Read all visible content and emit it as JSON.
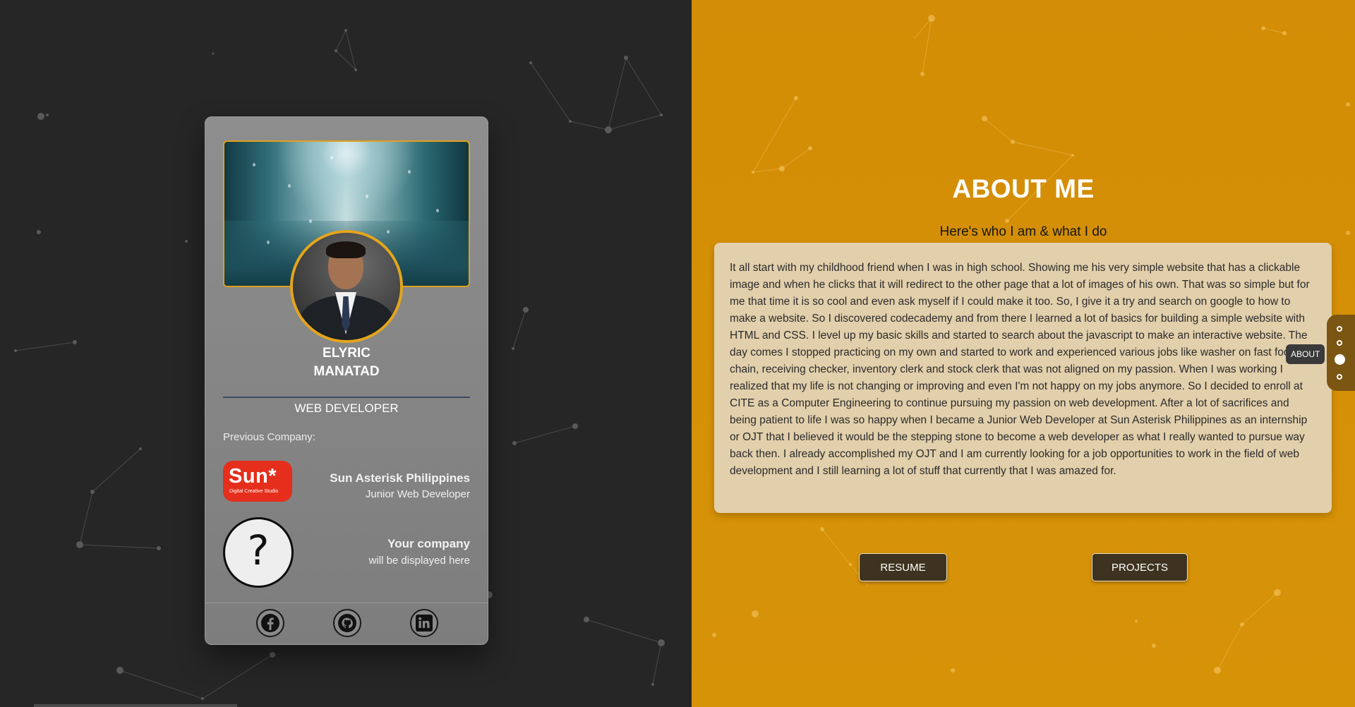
{
  "profile": {
    "first_name": "ELYRIC",
    "last_name": "MANATAD",
    "role": "WEB DEVELOPER",
    "previous_company_label": "Previous Company:",
    "companies": [
      {
        "logo_text": "Sun*",
        "logo_subtext": "Digital Creative Studio",
        "name": "Sun Asterisk Philippines",
        "position": "Junior Web Developer"
      },
      {
        "logo_text": "?",
        "name": "Your company",
        "position": "will be displayed here"
      }
    ],
    "social_icons": [
      "facebook-icon",
      "github-icon",
      "linkedin-icon"
    ]
  },
  "about": {
    "title": "ABOUT ME",
    "subtitle": "Here's who I am & what I do",
    "body": "It all start with my childhood friend when I was in high school. Showing me his very simple website that has a clickable image and when he clicks that it will redirect to the other page that a lot of images of his own. That was so simple but for me that time it is so cool and even ask myself if I could make it too. So, I give it a try and search on google to how to make a website. So I discovered codecademy and from there I learned a lot of basics for building a simple website with HTML and CSS. I level up my basic skills and started to search about the javascript to make an interactive website. The day comes I stopped practicing on my own and started to work and experienced various jobs like washer on fast food chain, receiving checker, inventory clerk and stock clerk that was not aligned on my passion. When I was working I realized that my life is not changing or improving and even I'm not happy on my jobs anymore. So I decided to enroll at CITE as a Computer Engineering to continue pursuing my passion on web development. After a lot of sacrifices and being patient to life I was so happy when I became a Junior Web Developer at Sun Asterisk Philippines as an internship or OJT that I believed it would be the stepping stone to become a web developer as what I really wanted to pursue way back then. I already accomplished my OJT and I am currently looking for a job opportunities to work in the field of web development and I still learning a lot of stuff that currently that I was amazed for.",
    "buttons": {
      "resume": "RESUME",
      "projects": "PROJECTS"
    }
  },
  "side_nav": {
    "active_index": 2,
    "tooltip": "ABOUT",
    "dot_count": 4
  },
  "colors": {
    "left_bg": "#262626",
    "right_bg": "#d38d06",
    "accent": "#e4a51c",
    "button_bg": "#3e3320"
  }
}
